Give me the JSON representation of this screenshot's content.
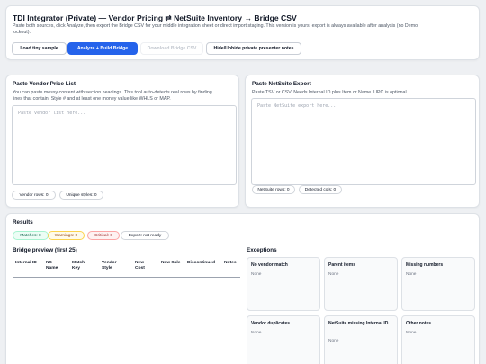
{
  "header": {
    "title": "TDI Integrator (Private) — Vendor Pricing ⇄ NetSuite Inventory → Bridge CSV",
    "subtitle_line1": "Paste both sources, click Analyze, then export the Bridge CSV for your middle integration sheet or direct import staging. This version is yours: export is always available after analysis (no Demo",
    "subtitle_line2": "lockout).",
    "buttons": {
      "load_sample": "Load tiny sample",
      "analyze": "Analyze + Build Bridge",
      "download": "Download Bridge CSV",
      "notes": "Hide/Unhide private presenter notes"
    }
  },
  "vendor": {
    "title": "Paste Vendor Price List",
    "help_line1": "You can paste messy content with section headings. This tool auto-detects real rows by finding",
    "help_line2": "lines that contain: Style # and at least one money value like WHLS or MAP.",
    "placeholder": "Paste vendor list here...",
    "rows_label": "Vendor rows: 0",
    "styles_label": "Unique styles: 0"
  },
  "netsuite": {
    "title": "Paste NetSuite Export",
    "help": "Paste TSV or CSV. Needs Internal ID plus Item or Name. UPC is optional.",
    "placeholder": "Paste NetSuite export here...",
    "rows_label": "NetSuite rows: 0",
    "cols_label": "Detected cols: 0"
  },
  "results": {
    "title": "Results",
    "matches": "Matches: 0",
    "warnings": "Warnings: 0",
    "critical": "Critical: 0",
    "export": "Export: not ready",
    "preview_title": "Bridge preview (first 25)",
    "columns": [
      "Internal ID",
      "NS Name",
      "Match Key",
      "Vendor Style",
      "New Cost",
      "New Sale",
      "Discontinued",
      "Notes"
    ],
    "exceptions_title": "Exceptions",
    "exceptions": [
      {
        "title": "No vendor match",
        "value": "None"
      },
      {
        "title": "Parent items",
        "value": "None"
      },
      {
        "title": "Missing numbers",
        "value": "None"
      },
      {
        "title": "Vendor duplicates",
        "value": "None"
      },
      {
        "title": "NetSuite missing Internal ID",
        "value": "None"
      },
      {
        "title": "Other notes",
        "value": "None"
      }
    ]
  },
  "colors": {
    "primary": "#2563eb",
    "background": "#eef0f3"
  }
}
